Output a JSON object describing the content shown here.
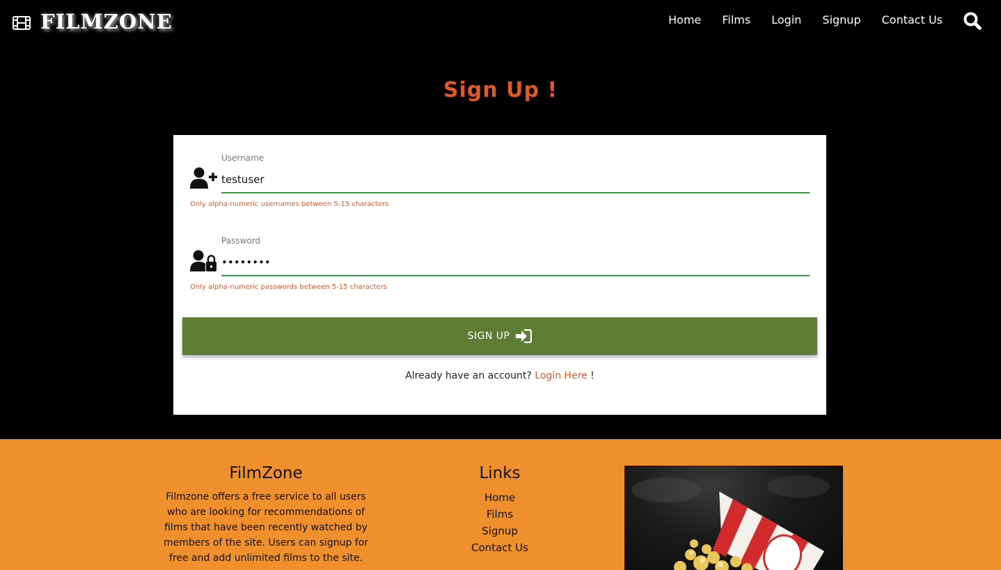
{
  "brand": {
    "name": "FILMZONE",
    "icon": "film-icon"
  },
  "nav": {
    "items": [
      "Home",
      "Films",
      "Login",
      "Signup",
      "Contact Us"
    ],
    "search_icon": "search-icon"
  },
  "page": {
    "title": "Sign Up !"
  },
  "form": {
    "username": {
      "label": "Username",
      "value": "testuser",
      "hint": "Only alpha-numeric usernames between 5-15 characters",
      "icon": "user-plus-icon"
    },
    "password": {
      "label": "Password",
      "value": "••••••••",
      "hint": "Only alpha-numeric passwords between 5-15 characters",
      "icon": "user-lock-icon"
    },
    "submit_label": "SIGN UP",
    "submit_icon": "sign-in-icon",
    "login_prompt": "Already have an account?",
    "login_link": "Login Here",
    "login_suffix": " !"
  },
  "footer": {
    "about_title": "FilmZone",
    "about_text": "Filmzone offers a free service to all users who are looking for recommendations of films that have been recently watched by members of the site. Users can signup for free and add unlimited films to the site.",
    "links_title": "Links",
    "links": [
      "Home",
      "Films",
      "Signup",
      "Contact Us"
    ],
    "image": "popcorn-image"
  },
  "colors": {
    "accent": "#e1582a",
    "button": "#5c7d33",
    "input_underline": "#2e9c47",
    "footer_bg": "#f0902d",
    "background": "#000000"
  }
}
